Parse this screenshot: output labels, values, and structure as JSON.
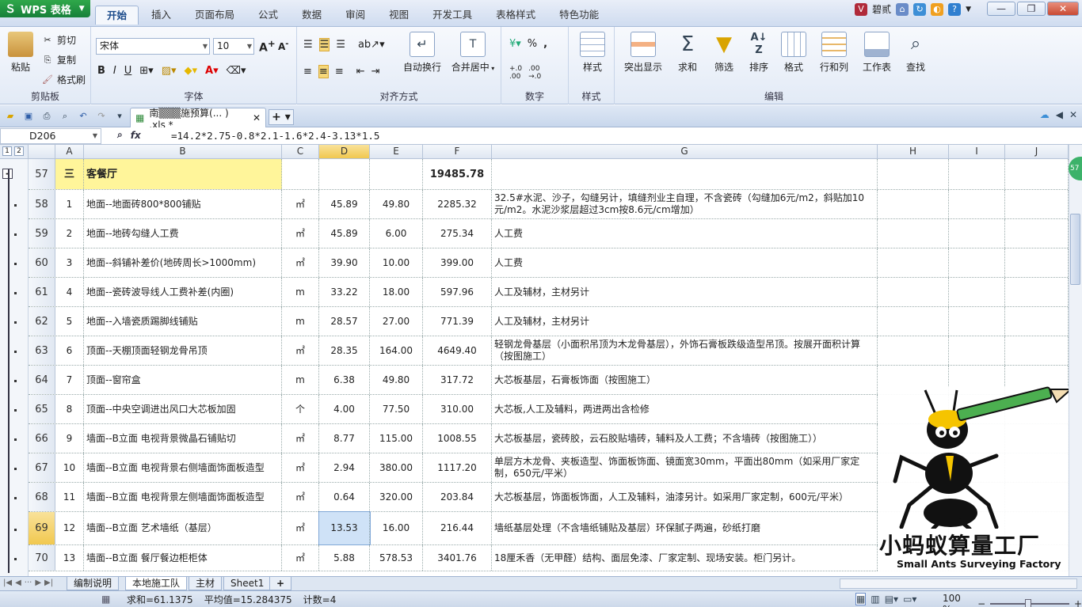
{
  "app": {
    "name": "WPS 表格",
    "user": "碧贰"
  },
  "menu_tabs": [
    "开始",
    "插入",
    "页面布局",
    "公式",
    "数据",
    "审阅",
    "视图",
    "开发工具",
    "表格样式",
    "特色功能"
  ],
  "ribbon": {
    "clipboard": {
      "paste": "粘贴",
      "cut": "剪切",
      "copy": "复制",
      "format_painter": "格式刷",
      "label": "剪贴板"
    },
    "font": {
      "name": "宋体",
      "size": "10",
      "label": "字体"
    },
    "align": {
      "wrap": "自动换行",
      "merge": "合并居中",
      "label": "对齐方式"
    },
    "number": {
      "percent": "%",
      "comma": ",",
      "label": "数字"
    },
    "style": {
      "styles": "样式",
      "label": "样式"
    },
    "edit": {
      "highlight": "突出显示",
      "sum": "求和",
      "filter": "筛选",
      "sort": "排序",
      "format": "格式",
      "rowcol": "行和列",
      "worksheet": "工作表",
      "find": "查找",
      "label": "编辑"
    }
  },
  "doc_tab": {
    "title": "南▒▒▒施预算(... ) .xls *"
  },
  "formula_bar": {
    "cell_ref": "D206",
    "formula": "=14.2*2.75-0.8*2.1-1.6*2.4-3.13*1.5"
  },
  "columns": [
    "A",
    "B",
    "C",
    "D",
    "E",
    "F",
    "G",
    "H",
    "I",
    "J"
  ],
  "rows": [
    {
      "num": "57",
      "a": "三",
      "b": "客餐厅",
      "c": "",
      "d": "",
      "e": "",
      "f": "19485.78",
      "g": ""
    },
    {
      "num": "58",
      "a": "1",
      "b": "地面--地面砖800*800铺贴",
      "c": "㎡",
      "d": "45.89",
      "e": "49.80",
      "f": "2285.32",
      "g": "32.5#水泥、沙子，勾缝另计，填缝剂业主自理，不含瓷砖（勾缝加6元/m2，斜贴加10元/m2。水泥沙浆层超过3cm按8.6元/cm增加）"
    },
    {
      "num": "59",
      "a": "2",
      "b": "地面--地砖勾缝人工费",
      "c": "㎡",
      "d": "45.89",
      "e": "6.00",
      "f": "275.34",
      "g": "人工费"
    },
    {
      "num": "60",
      "a": "3",
      "b": "地面--斜铺补差价(地砖周长>1000mm)",
      "c": "㎡",
      "d": "39.90",
      "e": "10.00",
      "f": "399.00",
      "g": "人工费"
    },
    {
      "num": "61",
      "a": "4",
      "b": "地面--瓷砖波导线人工费补差(内圈)",
      "c": "m",
      "d": "33.22",
      "e": "18.00",
      "f": "597.96",
      "g": "人工及辅材，主材另计"
    },
    {
      "num": "62",
      "a": "5",
      "b": "地面--入墙瓷质踢脚线铺贴",
      "c": "m",
      "d": "28.57",
      "e": "27.00",
      "f": "771.39",
      "g": "人工及辅材，主材另计"
    },
    {
      "num": "63",
      "a": "6",
      "b": "顶面--天棚顶面轻钢龙骨吊顶",
      "c": "㎡",
      "d": "28.35",
      "e": "164.00",
      "f": "4649.40",
      "g": "轻钢龙骨基层（小面积吊顶为木龙骨基层），外饰石膏板跌级造型吊顶。按展开面积计算（按图施工）"
    },
    {
      "num": "64",
      "a": "7",
      "b": "顶面--窗帘盒",
      "c": "m",
      "d": "6.38",
      "e": "49.80",
      "f": "317.72",
      "g": "大芯板基层，石膏板饰面（按图施工）"
    },
    {
      "num": "65",
      "a": "8",
      "b": "顶面--中央空调进出风口大芯板加固",
      "c": "个",
      "d": "4.00",
      "e": "77.50",
      "f": "310.00",
      "g": "大芯板,人工及辅料，两进两出含检修"
    },
    {
      "num": "66",
      "a": "9",
      "b": "墙面--B立面 电视背景微晶石铺贴切",
      "c": "㎡",
      "d": "8.77",
      "e": "115.00",
      "f": "1008.55",
      "g": "大芯板基层，瓷砖胶，云石胶贴墙砖，辅料及人工费；不含墙砖（按图施工））"
    },
    {
      "num": "67",
      "a": "10",
      "b": "墙面--B立面 电视背景右侧墙面饰面板造型",
      "c": "㎡",
      "d": "2.94",
      "e": "380.00",
      "f": "1117.20",
      "g": "单层方木龙骨、夹板造型、饰面板饰面、镜面宽30mm，平面出80mm（如采用厂家定制，650元/平米）"
    },
    {
      "num": "68",
      "a": "11",
      "b": "墙面--B立面 电视背景左侧墙面饰面板造型",
      "c": "㎡",
      "d": "0.64",
      "e": "320.00",
      "f": "203.84",
      "g": "大芯板基层，饰面板饰面，人工及辅料，油漆另计。如采用厂家定制，600元/平米）"
    },
    {
      "num": "69",
      "a": "12",
      "b": "墙面--B立面 艺术墙纸（基层）",
      "c": "㎡",
      "d": "13.53",
      "e": "16.00",
      "f": "216.44",
      "g": "墙纸基层处理（不含墙纸铺贴及基层）环保腻子两遍，砂纸打磨"
    },
    {
      "num": "70",
      "a": "13",
      "b": "墙面--B立面 餐厅餐边柜柜体",
      "c": "㎡",
      "d": "5.88",
      "e": "578.53",
      "f": "3401.76",
      "g": "18厘禾香（无甲醛）结构、面层免漆、厂家定制、现场安装。柜门另计。"
    }
  ],
  "sheet_tabs": [
    "编制说明",
    "本地施工队",
    "主材",
    "Sheet1"
  ],
  "status": {
    "sum": "求和=61.1375",
    "avg": "平均值=15.284375",
    "count": "计数=4",
    "zoom": "100 %"
  },
  "watermark": {
    "title": "小蚂蚁算量工厂",
    "subtitle": "Small Ants Surveying Factory"
  },
  "side_badge": "57"
}
